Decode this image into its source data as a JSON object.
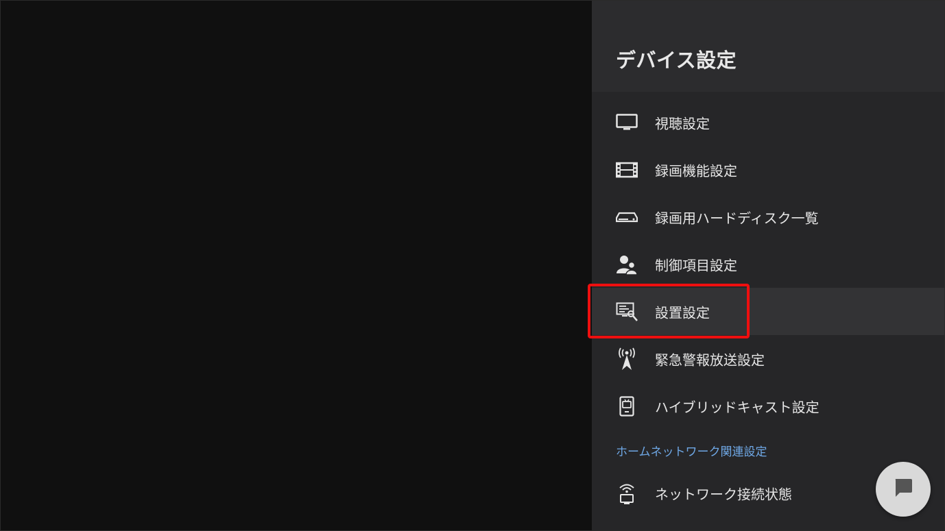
{
  "panel": {
    "title": "デバイス設定"
  },
  "menu": {
    "items": [
      {
        "label": "視聴設定",
        "icon": "tv-icon"
      },
      {
        "label": "録画機能設定",
        "icon": "film-icon"
      },
      {
        "label": "録画用ハードディスク一覧",
        "icon": "hard-disk-icon"
      },
      {
        "label": "制御項目設定",
        "icon": "users-icon"
      },
      {
        "label": "設置設定",
        "icon": "setup-icon",
        "focused": true
      },
      {
        "label": "緊急警報放送設定",
        "icon": "antenna-icon"
      },
      {
        "label": "ハイブリッドキャスト設定",
        "icon": "hybridcast-icon"
      }
    ],
    "section_header": "ホームネットワーク関連設定",
    "network_item": {
      "label": "ネットワーク接続状態",
      "icon": "network-icon"
    }
  },
  "colors": {
    "highlight": "#ee0f0f",
    "section_header": "#6fa8e6",
    "panel_bg": "#2c2c2e",
    "focused_bg": "#333335"
  },
  "chat_button": {
    "icon": "chat-icon"
  }
}
